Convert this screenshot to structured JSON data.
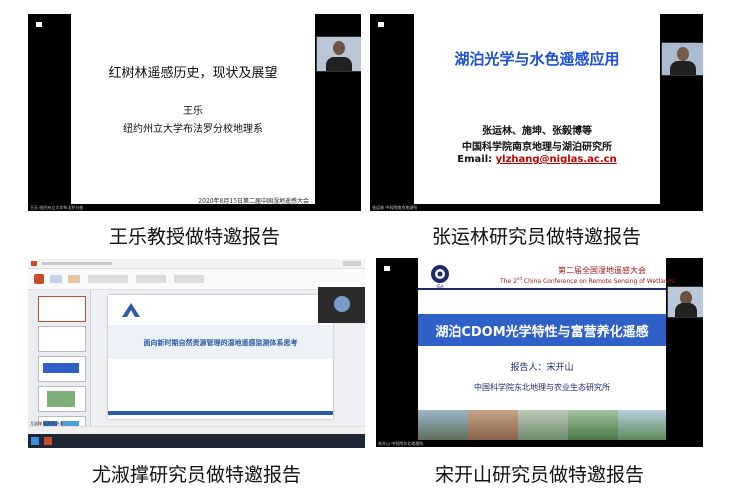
{
  "panels": [
    {
      "id": "panel-1",
      "slide": {
        "title": "红树林遥感历史，现状及展望",
        "author": "王乐",
        "affiliation": "纽约州立大学布法罗分校地理系",
        "footer": "2020年8月15日第二届中国湿地遥感大会"
      },
      "bottom_label": "王乐 纽约州立大学布法罗分校",
      "caption": "王乐教授做特邀报告"
    },
    {
      "id": "panel-2",
      "slide": {
        "title": "湖泊光学与水色遥感应用",
        "authors": "张运林、施坤、张毅博等",
        "affiliation": "中国科学院南京地理与湖泊研究所",
        "email_label": "Email:",
        "email": "ylzhang@niglas.ac.cn"
      },
      "bottom_label": "张运林 中科院南京地湖所",
      "caption": "张运林研究员做特邀报告"
    },
    {
      "id": "panel-3",
      "slide": {
        "title": "面向新时期自然资源管理的湿地遥感监测体系思考"
      },
      "bottom_label": "尤淑撑 自然资源部",
      "caption": "尤淑撑研究员做特邀报告"
    },
    {
      "id": "panel-4",
      "slide": {
        "conf_cn": "第二届全国湿地遥感大会",
        "conf_en_prefix": "The",
        "conf_en_sup": "nd",
        "conf_en_num": "2",
        "conf_en_rest": "China Conference on Remote Sensing of Wetlands",
        "logo_text": "IGA",
        "title": "湖泊CDOM光学特性与富营养化遥感",
        "reporter": "报告人：宋开山",
        "affiliation": "中国科学院东北地理与农业生态研究所"
      },
      "bottom_label": "宋开山 中科院东北地理所",
      "caption": "宋开山研究员做特邀报告"
    }
  ],
  "colors": {
    "p2_title": "#1a4fd6",
    "p2_email": "#c00000",
    "p3_title": "#2a5aa8",
    "p3_toolbar": "#c94b2b",
    "p4_banner": "#2f60c8",
    "p4_conf": "#a01818",
    "p4_dark": "#1a2a6a"
  }
}
